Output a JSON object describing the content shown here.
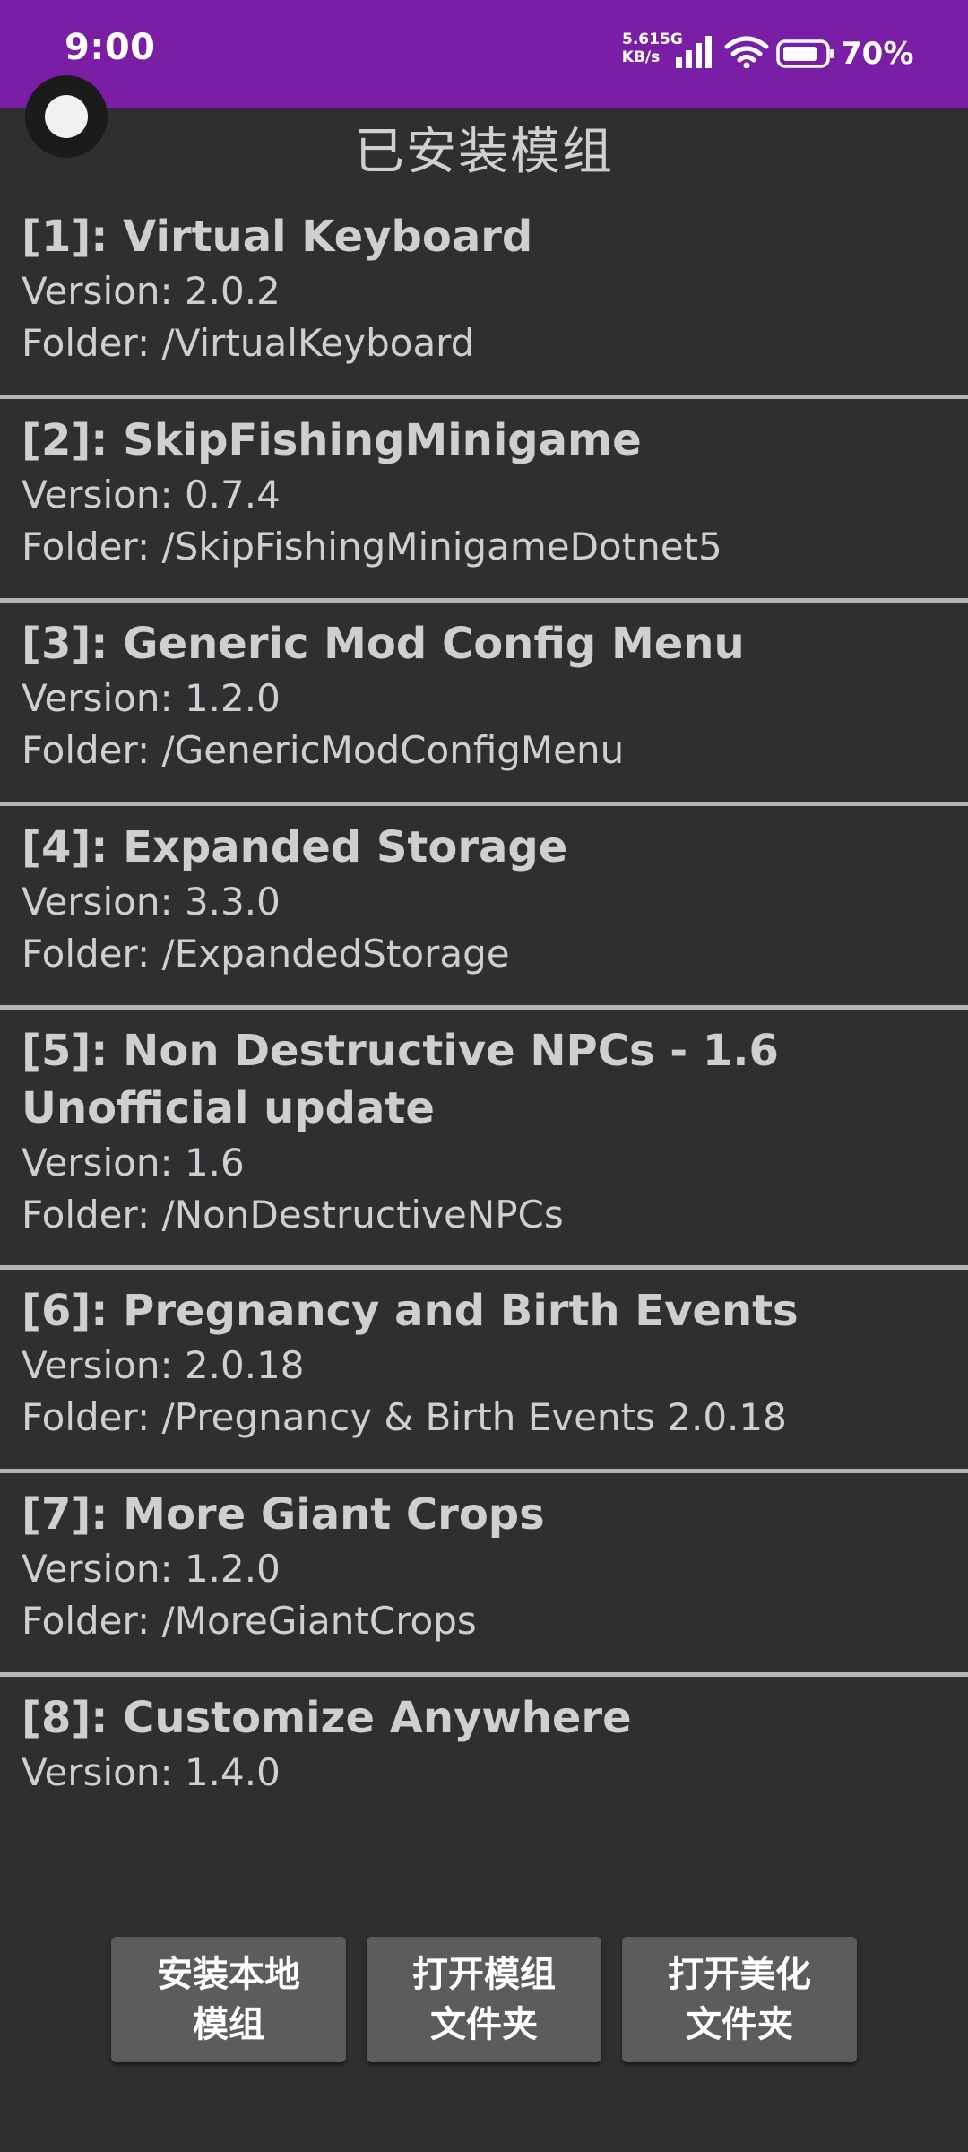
{
  "status_bar": {
    "time": "9:00",
    "net_speed_value": "5.61",
    "net_speed_unit": "KB/s",
    "network": "5G",
    "battery": "70%",
    "color": "#7a1fa5"
  },
  "header": {
    "title": "已安装模组"
  },
  "mods": [
    {
      "name": "[1]: Virtual Keyboard",
      "version": "Version: 2.0.2",
      "folder": "Folder: /VirtualKeyboard"
    },
    {
      "name": "[2]: SkipFishingMinigame",
      "version": "Version: 0.7.4",
      "folder": "Folder: /SkipFishingMinigameDotnet5"
    },
    {
      "name": "[3]: Generic Mod Config Menu",
      "version": "Version: 1.2.0",
      "folder": "Folder: /GenericModConfigMenu"
    },
    {
      "name": "[4]: Expanded Storage",
      "version": "Version: 3.3.0",
      "folder": "Folder: /ExpandedStorage"
    },
    {
      "name_line1": "[5]: Non Destructive NPCs - 1.6",
      "name_line2": "Unofficial update",
      "version": "Version: 1.6",
      "folder": "Folder: /NonDestructiveNPCs"
    },
    {
      "name": "[6]: Pregnancy and Birth Events",
      "version": "Version: 2.0.18",
      "folder": "Folder: /Pregnancy & Birth Events 2.0.18"
    },
    {
      "name": "[7]: More Giant Crops",
      "version": "Version: 1.2.0",
      "folder": "Folder: /MoreGiantCrops"
    },
    {
      "name": "[8]: Customize Anywhere",
      "version": "Version: 1.4.0"
    }
  ],
  "actions": {
    "install_local_line1": "安装本地",
    "install_local_line2": "模组",
    "open_mods_folder_line1": "打开模组",
    "open_mods_folder_line2": "文件夹",
    "open_beautify_folder_line1": "打开美化",
    "open_beautify_folder_line2": "文件夹"
  },
  "icons": {
    "signal": "signal-icon",
    "wifi": "wifi-icon",
    "battery": "battery-icon"
  }
}
